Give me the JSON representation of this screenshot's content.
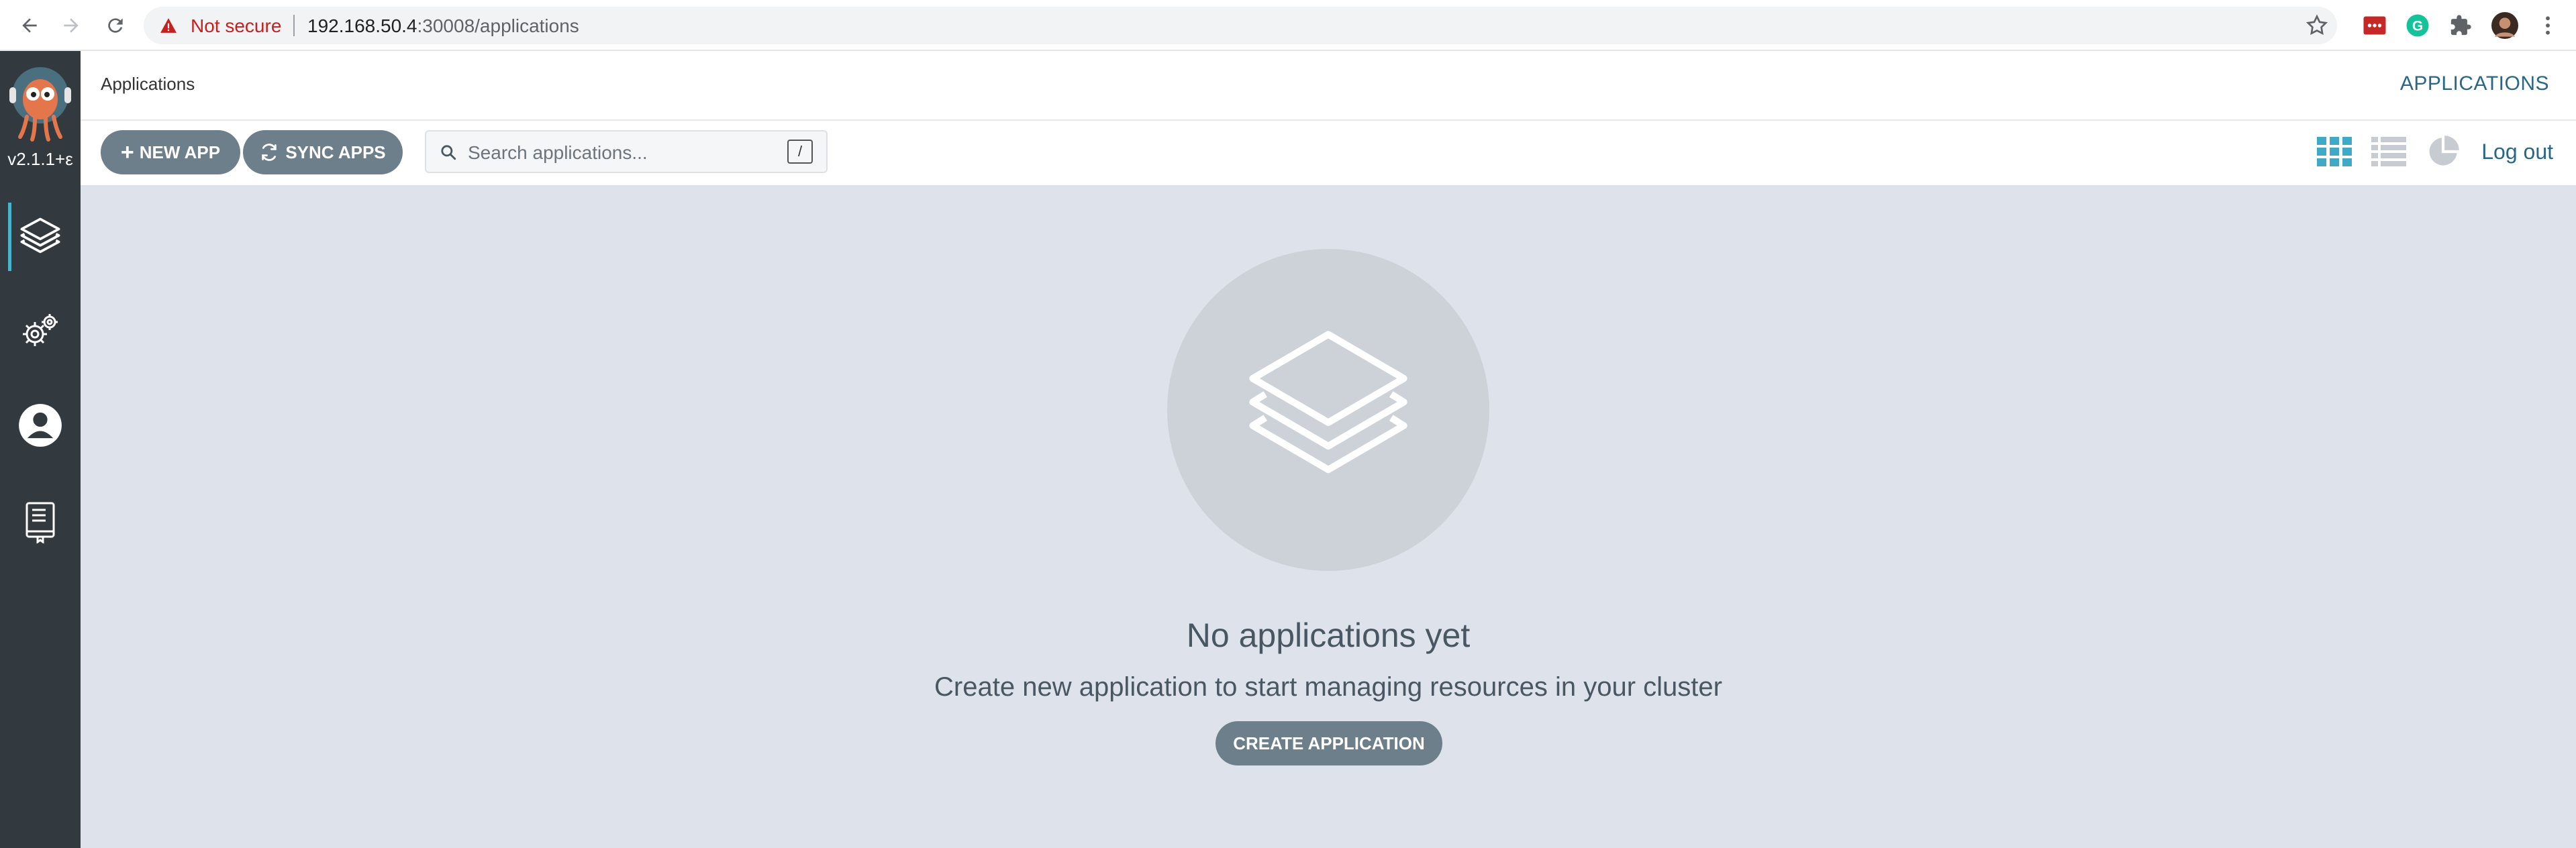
{
  "browser": {
    "security_label": "Not secure",
    "url_host": "192.168.50.4",
    "url_rest": ":30008/applications",
    "icons": [
      "back-arrow-icon",
      "forward-arrow-icon",
      "reload-icon",
      "warning-icon",
      "star-icon",
      "extension-icon",
      "grammarly-icon",
      "puzzle-icon",
      "profile-avatar",
      "kebab-menu-icon"
    ]
  },
  "sidebar": {
    "version": "v2.1.1+ε",
    "items": [
      {
        "name": "applications",
        "icon": "layers-icon",
        "active": true
      },
      {
        "name": "settings",
        "icon": "gears-icon",
        "active": false
      },
      {
        "name": "user-info",
        "icon": "user-circle-icon",
        "active": false
      },
      {
        "name": "documentation",
        "icon": "book-icon",
        "active": false
      }
    ]
  },
  "header": {
    "title": "Applications",
    "right_link": "APPLICATIONS"
  },
  "toolbar": {
    "new_app_label": "NEW APP",
    "sync_apps_label": "SYNC APPS",
    "search_placeholder": "Search applications...",
    "search_shortcut": "/",
    "logout_label": "Log out",
    "views": [
      "tiles-view-icon",
      "list-view-icon",
      "summary-pie-icon"
    ]
  },
  "empty_state": {
    "title": "No applications yet",
    "subtitle": "Create new application to start managing resources in your cluster",
    "button_label": "CREATE APPLICATION"
  },
  "colors": {
    "sidebar_bg": "#333a3f",
    "accent": "#286787",
    "button_bg": "#6d7f8b",
    "main_bg": "#dee3eb",
    "active_indicator": "#4db2c7"
  }
}
